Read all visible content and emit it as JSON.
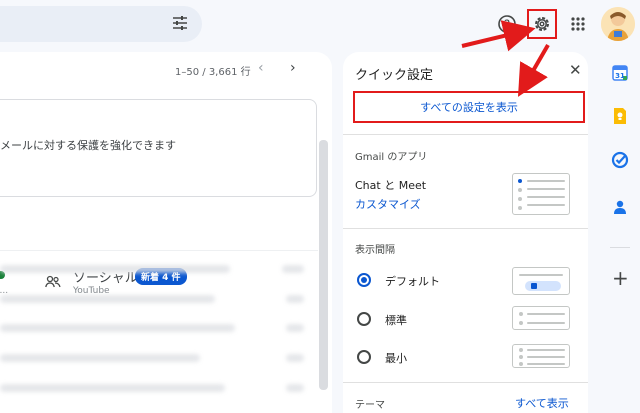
{
  "toolbar": {
    "tune_icon": "tune-icon",
    "help_icon": "help-icon",
    "settings_icon": "gear-icon",
    "apps_icon": "apps-grid-icon",
    "avatar_icon": "avatar"
  },
  "mail": {
    "pagination": "1–50 / 3,661 行",
    "prev_icon": "chevron-left-icon",
    "next_icon": "chevron-right-icon",
    "security_text": "メールに対する保護を強化できます",
    "left_tab_sub": "e...",
    "social_tab": {
      "label": "ソーシャル",
      "badge": "新着 4 件",
      "sub": "YouTube"
    }
  },
  "quick_settings": {
    "title": "クイック設定",
    "close_icon": "close-icon",
    "all_settings_button": "すべての設定を表示",
    "apps_section_title": "Gmail のアプリ",
    "chat_meet_label": "Chat と Meet",
    "customize_link": "カスタマイズ",
    "density_title": "表示間隔",
    "density_options": [
      {
        "label": "デフォルト",
        "selected": true
      },
      {
        "label": "標準",
        "selected": false
      },
      {
        "label": "最小",
        "selected": false
      }
    ],
    "theme_title": "テーマ",
    "theme_link": "すべて表示"
  },
  "colors": {
    "accent": "#0b57d0",
    "highlight": "#e21b1b"
  }
}
